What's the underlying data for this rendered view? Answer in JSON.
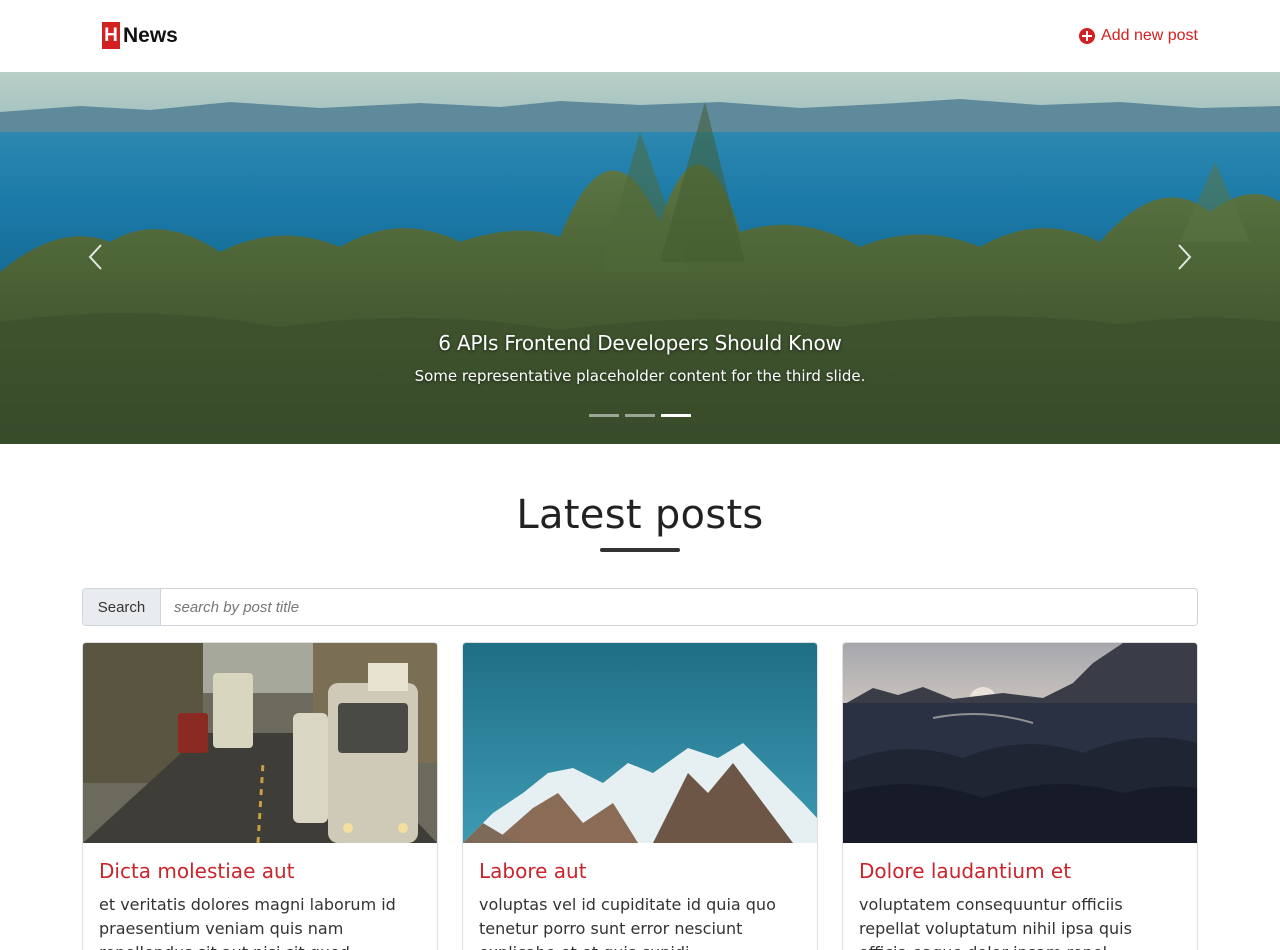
{
  "navbar": {
    "brand_mark": "H",
    "brand_text": "News",
    "add_post_label": "Add new post",
    "accent_color": "#d32020"
  },
  "carousel": {
    "slide_title": "6 APIs Frontend Developers Should Know",
    "slide_text": "Some representative placeholder content for the third slide.",
    "indicator_count": 3,
    "active_index": 2,
    "prev_icon": "chevron-left-icon",
    "next_icon": "chevron-right-icon"
  },
  "main": {
    "heading": "Latest posts"
  },
  "search": {
    "label": "Search",
    "placeholder": "search by post title",
    "value": ""
  },
  "posts": [
    {
      "title": "Dicta molestiae aut",
      "excerpt": "et veritatis dolores magni laborum id praesentium veniam quis nam repellendus sit aut nisi sit quod"
    },
    {
      "title": "Labore aut",
      "excerpt": "voluptas vel id cupiditate id quia quo tenetur porro sunt error nesciunt explicabo et et quis cupidi"
    },
    {
      "title": "Dolore laudantium et",
      "excerpt": "voluptatem consequuntur officiis repellat voluptatum nihil ipsa quis officia eaque dolor ipsam repel"
    }
  ]
}
